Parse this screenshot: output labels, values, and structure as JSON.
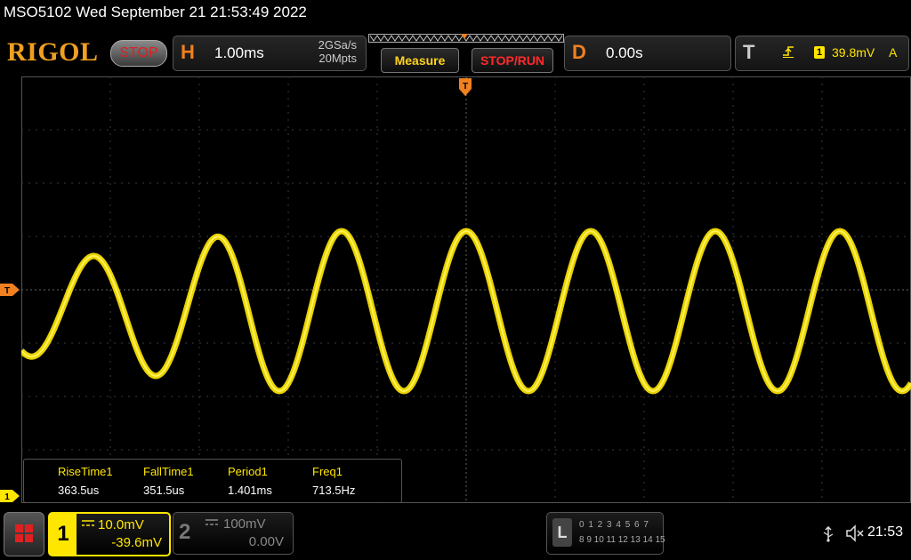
{
  "status_line": "MSO5102  Wed September 21 21:53:49 2022",
  "header": {
    "logo": "RIGOL",
    "run_state": "STOP",
    "horizontal": {
      "letter": "H",
      "timebase": "1.00ms",
      "sample_rate": "2GSa/s",
      "memory_depth": "20Mpts"
    },
    "measure_label": "Measure",
    "stop_run_label": "STOP/RUN",
    "delay": {
      "letter": "D",
      "value": "0.00s"
    },
    "trigger": {
      "letter": "T",
      "source": "1",
      "level": "39.8mV",
      "mode": "A"
    }
  },
  "markers": {
    "trigger_position": "T",
    "trigger_level": "T",
    "channel1": "1"
  },
  "measurements": [
    {
      "name": "RiseTime1",
      "value": "363.5us"
    },
    {
      "name": "FallTime1",
      "value": "351.5us"
    },
    {
      "name": "Period1",
      "value": "1.401ms"
    },
    {
      "name": "Freq1",
      "value": "713.5Hz"
    }
  ],
  "channels": [
    {
      "number": "1",
      "scale": "10.0mV",
      "offset": "-39.6mV",
      "active": true
    },
    {
      "number": "2",
      "scale": "100mV",
      "offset": "0.00V",
      "active": false
    }
  ],
  "logic_analyzer": {
    "letter": "L",
    "row1": "0 1 2 3  4 5 6 7",
    "row2": "8  9 10 11 12 13 14 15"
  },
  "clock": "21:53",
  "colors": {
    "ch1": "#ffe600",
    "accent": "#f08020",
    "stop": "#e02020"
  },
  "waveform": {
    "type": "sine",
    "period_divisions": 1.4,
    "amplitude_divisions": 1.5,
    "center_division_offset": 0.4,
    "phase_at_trigger_deg": 90
  },
  "icons": [
    "menu-icon",
    "trigger-edge-icon",
    "usb-icon",
    "speaker-muted-icon",
    "dc-coupling-icon"
  ]
}
